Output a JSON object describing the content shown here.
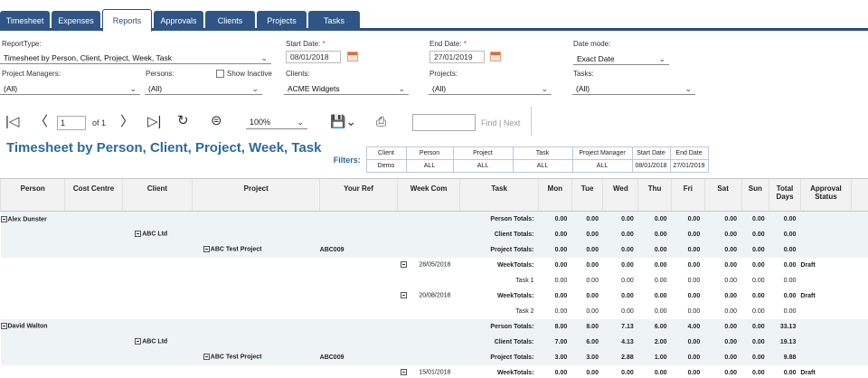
{
  "tabs": [
    "Timesheet",
    "Expenses",
    "Reports",
    "Approvals",
    "Clients",
    "Projects",
    "Tasks"
  ],
  "active_tab": "Reports",
  "filters": {
    "report_type_label": "ReportType:",
    "report_type_value": "Timesheet by Person, Client, Project, Week, Task",
    "start_date_label": "Start Date:",
    "start_date_value": "08/01/2018",
    "end_date_label": "End Date:",
    "end_date_value": "27/01/2019",
    "required_mark": "*",
    "date_mode_label": "Date mode:",
    "date_mode_value": "Exact Date",
    "project_managers_label": "Project Managers:",
    "project_managers_value": "(All)",
    "persons_label": "Persons:",
    "persons_value": "(All)",
    "show_inactive_label": "Show Inactive",
    "clients_label": "Clients:",
    "clients_value": "ACME Widgets",
    "projects_label": "Projects:",
    "projects_value": "(All)",
    "tasks_label": "Tasks:",
    "tasks_value": "(All)"
  },
  "toolbar": {
    "page_value": "1",
    "page_of": "of 1",
    "zoom": "100%",
    "find": "Find",
    "find_sep": "|",
    "next": "Next"
  },
  "report": {
    "title": "Timesheet by Person, Client, Project, Week, Task",
    "filters_label": "Filters:",
    "filter_headers": [
      "Client",
      "Person",
      "Project",
      "Task",
      "Project Manager",
      "Start Date",
      "End Date"
    ],
    "filter_values": [
      "Demo",
      "ALL",
      "ALL",
      "ALL",
      "ALL",
      "08/01/2018",
      "27/01/2019"
    ]
  },
  "grid": {
    "columns": [
      "Person",
      "Cost Centre",
      "Client",
      "Project",
      "Your Ref",
      "Week Com",
      "Task",
      "Mon",
      "Tue",
      "Wed",
      "Thu",
      "Fri",
      "Sat",
      "Sun",
      "Total Days",
      "Approval Status"
    ],
    "rows": [
      {
        "type": "person",
        "person": "Alex Dunster",
        "label": "Person Totals:",
        "vals": [
          "0.00",
          "0.00",
          "0.00",
          "0.00",
          "0.00",
          "0.00",
          "0.00",
          "0.00"
        ],
        "status": ""
      },
      {
        "type": "client",
        "client": "ABC Ltd",
        "label": "Client Totals:",
        "vals": [
          "0.00",
          "0.00",
          "0.00",
          "0.00",
          "0.00",
          "0.00",
          "0.00",
          "0.00"
        ],
        "status": ""
      },
      {
        "type": "project",
        "project": "ABC Test Project",
        "ref": "ABC009",
        "label": "Project Totals:",
        "vals": [
          "0.00",
          "0.00",
          "0.00",
          "0.00",
          "0.00",
          "0.00",
          "0.00",
          "0.00"
        ],
        "status": ""
      },
      {
        "type": "week",
        "week": "28/05/2018",
        "label": "WeekTotals:",
        "vals": [
          "0.00",
          "0.00",
          "0.00",
          "0.00",
          "0.00",
          "0.00",
          "0.00",
          "0.00"
        ],
        "status": "Draft"
      },
      {
        "type": "task",
        "task": "Task 1",
        "vals": [
          "0.00",
          "0.00",
          "0.00",
          "0.00",
          "0.00",
          "0.00",
          "0.00",
          "0.00"
        ],
        "status": ""
      },
      {
        "type": "week",
        "week": "20/08/2018",
        "label": "WeekTotals:",
        "vals": [
          "0.00",
          "0.00",
          "0.00",
          "0.00",
          "0.00",
          "0.00",
          "0.00",
          "0.00"
        ],
        "status": "Draft"
      },
      {
        "type": "task",
        "task": "Task 2",
        "vals": [
          "0.00",
          "0.00",
          "0.00",
          "0.00",
          "0.00",
          "0.00",
          "0.00",
          "0.00"
        ],
        "status": ""
      },
      {
        "type": "person",
        "person": "David Walton",
        "label": "Person Totals:",
        "vals": [
          "8.00",
          "8.00",
          "7.13",
          "6.00",
          "4.00",
          "0.00",
          "0.00",
          "33.13"
        ],
        "status": ""
      },
      {
        "type": "client",
        "client": "ABC Ltd",
        "label": "Client Totals:",
        "vals": [
          "7.00",
          "6.00",
          "4.13",
          "2.00",
          "0.00",
          "0.00",
          "0.00",
          "19.13"
        ],
        "status": ""
      },
      {
        "type": "project",
        "project": "ABC Test Project",
        "ref": "ABC009",
        "label": "Project Totals:",
        "vals": [
          "3.00",
          "3.00",
          "2.88",
          "1.00",
          "0.00",
          "0.00",
          "0.00",
          "9.88"
        ],
        "status": ""
      },
      {
        "type": "week",
        "week": "15/01/2018",
        "label": "WeekTotals:",
        "vals": [
          "0.00",
          "0.00",
          "0.00",
          "0.00",
          "0.00",
          "0.00",
          "0.00",
          "0.00"
        ],
        "status": "Draft"
      }
    ]
  },
  "icons": {
    "first": "first-page-icon",
    "prev": "prev-page-icon",
    "next": "next-page-icon",
    "last": "last-page-icon",
    "refresh": "refresh-icon",
    "back": "back-icon",
    "save": "save-icon",
    "print": "print-icon",
    "calendar": "calendar-icon",
    "chevron": "chevron-down-icon",
    "expand": "collapse-icon"
  },
  "colors": {
    "tab_bg": "#2f5586",
    "title": "#2c6aa0",
    "row_shade": "#eef3f6"
  }
}
